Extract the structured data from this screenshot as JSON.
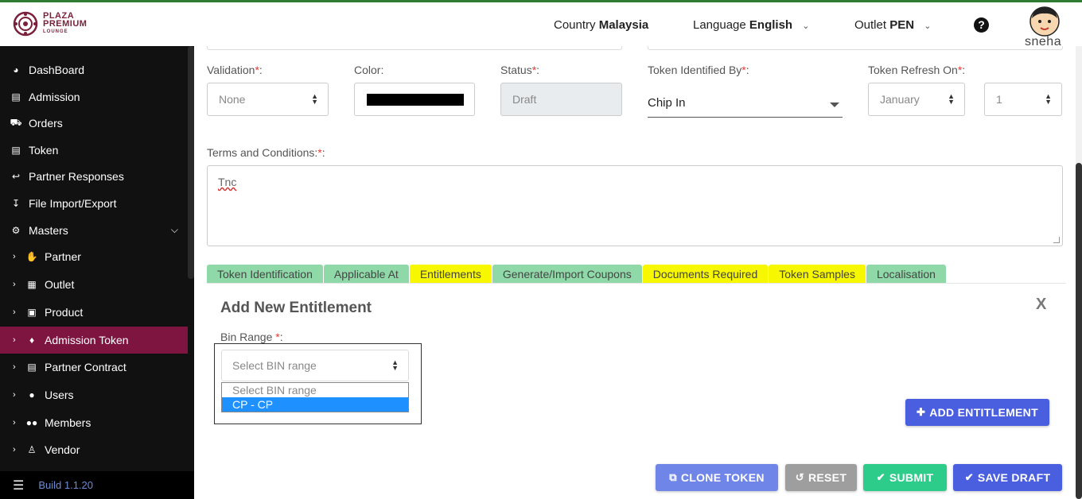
{
  "header": {
    "logo_line1": "PLAZA",
    "logo_line2": "PREMIUM",
    "logo_line3": "LOUNGE",
    "country_label": "Country",
    "country_value": "Malaysia",
    "language_label": "Language",
    "language_value": "English",
    "outlet_label": "Outlet",
    "outlet_value": "PEN",
    "help_glyph": "?",
    "username": "sneha"
  },
  "sidebar": {
    "items": [
      {
        "label": "DashBoard",
        "icon": "dashboard-icon"
      },
      {
        "label": "Admission",
        "icon": "admission-card-icon"
      },
      {
        "label": "Orders",
        "icon": "cart-icon"
      },
      {
        "label": "Token",
        "icon": "file-icon"
      },
      {
        "label": "Partner Responses",
        "icon": "reply-icon"
      },
      {
        "label": "File Import/Export",
        "icon": "download-icon"
      },
      {
        "label": "Masters",
        "icon": "sitemap-icon"
      }
    ],
    "sub_items": [
      {
        "label": "Partner",
        "icon": "handshake-icon"
      },
      {
        "label": "Outlet",
        "icon": "building-icon"
      },
      {
        "label": "Product",
        "icon": "gift-icon"
      },
      {
        "label": "Admission Token",
        "icon": "ticket-icon"
      },
      {
        "label": "Partner Contract",
        "icon": "briefcase-icon"
      },
      {
        "label": "Users",
        "icon": "user-icon"
      },
      {
        "label": "Members",
        "icon": "users-icon"
      },
      {
        "label": "Vendor",
        "icon": "person-icon"
      }
    ],
    "build": "Build 1.1.20",
    "active_color": "#7d1540"
  },
  "form": {
    "validation_label": "Validation",
    "validation_value": "None",
    "color_label": "Color:",
    "status_label": "Status",
    "status_value": "Draft",
    "token_identified_label": "Token Identified By",
    "token_identified_value": "Chip In",
    "token_refresh_label": "Token Refresh On",
    "token_refresh_month": "January",
    "token_refresh_day": "1",
    "terms_label": "Terms and Conditions:",
    "terms_value": "Tnc",
    "required_mark": "*",
    "colon": ":"
  },
  "tabs": [
    {
      "label": "Token Identification",
      "color": "green"
    },
    {
      "label": "Applicable At",
      "color": "green"
    },
    {
      "label": "Entitlements",
      "color": "yellow"
    },
    {
      "label": "Generate/Import Coupons",
      "color": "green"
    },
    {
      "label": "Documents Required",
      "color": "yellow"
    },
    {
      "label": "Token Samples",
      "color": "yellow"
    },
    {
      "label": "Localisation",
      "color": "green"
    }
  ],
  "entitlement": {
    "title": "Add New Entitlement",
    "close": "X",
    "bin_label": "Bin Range",
    "bin_placeholder": "Select BIN range",
    "options": [
      "Select BIN range",
      "CP - CP"
    ],
    "add_button": "ADD ENTITLEMENT"
  },
  "actions": {
    "clone": "CLONE TOKEN",
    "reset": "RESET",
    "submit": "SUBMIT",
    "save_draft": "SAVE DRAFT"
  },
  "colors": {
    "primary": "#4a5fe0",
    "clone": "#6f86e8",
    "reset": "#9e9e9e",
    "submit": "#2ecc8a",
    "tab_green": "#8fd9a8",
    "tab_yellow": "#f7f700"
  }
}
